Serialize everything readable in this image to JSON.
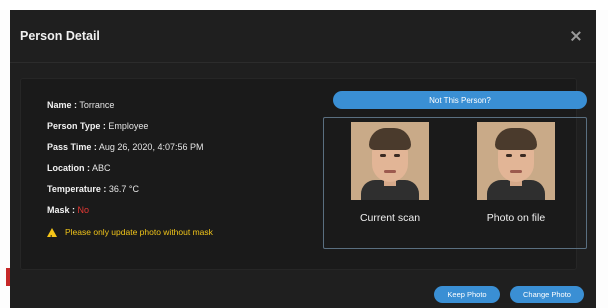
{
  "dialog": {
    "title": "Person Detail"
  },
  "details": {
    "name_label": "Name :",
    "name_value": "Torrance",
    "person_type_label": "Person Type :",
    "person_type_value": "Employee",
    "pass_time_label": "Pass Time :",
    "pass_time_value": "Aug 26, 2020, 4:07:56 PM",
    "location_label": "Location :",
    "location_value": "ABC",
    "temperature_label": "Temperature :",
    "temperature_value": "36.7 °C",
    "mask_label": "Mask :",
    "mask_value": "No",
    "warning_text": "Please only update photo without mask"
  },
  "compare": {
    "not_this_person_label": "Not This Person?",
    "current_scan_caption": "Current scan",
    "photo_on_file_caption": "Photo on file"
  },
  "footer": {
    "keep_photo_label": "Keep Photo",
    "change_photo_label": "Change Photo"
  },
  "colors": {
    "accent": "#3a8fd4",
    "warning": "#f0c419",
    "mask_alert": "#e53935",
    "background": "#1f1f1f"
  }
}
